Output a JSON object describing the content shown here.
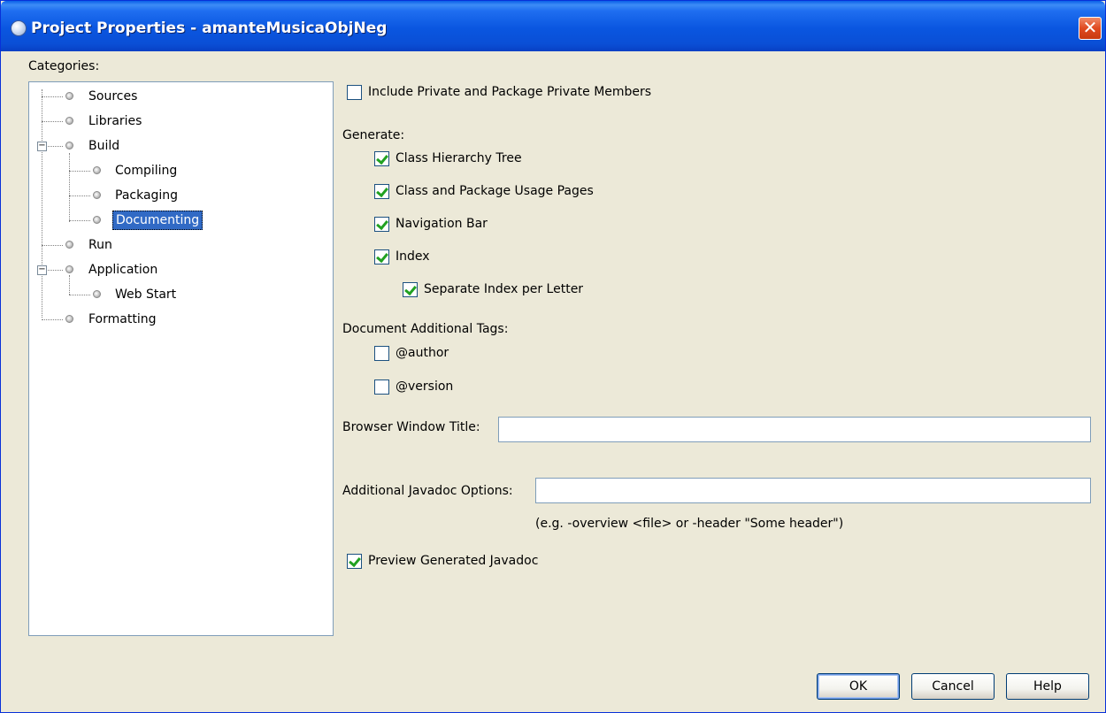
{
  "window": {
    "title": "Project Properties - amanteMusicaObjNeg",
    "close_glyph": "✕"
  },
  "categories": {
    "label": "Categories:",
    "items": [
      {
        "label": "Sources"
      },
      {
        "label": "Libraries"
      },
      {
        "label": "Build",
        "expanded": true
      },
      {
        "label": "Compiling"
      },
      {
        "label": "Packaging"
      },
      {
        "label": "Documenting",
        "selected": true
      },
      {
        "label": "Run"
      },
      {
        "label": "Application",
        "expanded": true
      },
      {
        "label": "Web Start"
      },
      {
        "label": "Formatting"
      }
    ]
  },
  "options": {
    "include_private": {
      "label": "Include Private and Package Private Members",
      "checked": false
    },
    "generate_label": "Generate:",
    "class_hierarchy": {
      "label": "Class Hierarchy Tree",
      "checked": true
    },
    "usage_pages": {
      "label": "Class and Package Usage Pages",
      "checked": true
    },
    "navigation_bar": {
      "label": "Navigation Bar",
      "checked": true
    },
    "index": {
      "label": "Index",
      "checked": true
    },
    "separate_index": {
      "label": "Separate Index per Letter",
      "checked": true
    },
    "additional_tags_label": "Document Additional Tags:",
    "author": {
      "label": "@author",
      "checked": false
    },
    "version": {
      "label": "@version",
      "checked": false
    },
    "browser_title": {
      "label": "Browser Window Title:",
      "value": ""
    },
    "javadoc_options": {
      "label": "Additional Javadoc Options:",
      "value": "",
      "hint": "(e.g. -overview <file> or -header \"Some header\")"
    },
    "preview": {
      "label": "Preview Generated Javadoc",
      "checked": true
    }
  },
  "buttons": {
    "ok": "OK",
    "cancel": "Cancel",
    "help": "Help"
  },
  "colors": {
    "titlebar": "#0a56e0",
    "selection": "#316ac5",
    "dialog_bg": "#ece9d8",
    "check": "#21a121"
  }
}
